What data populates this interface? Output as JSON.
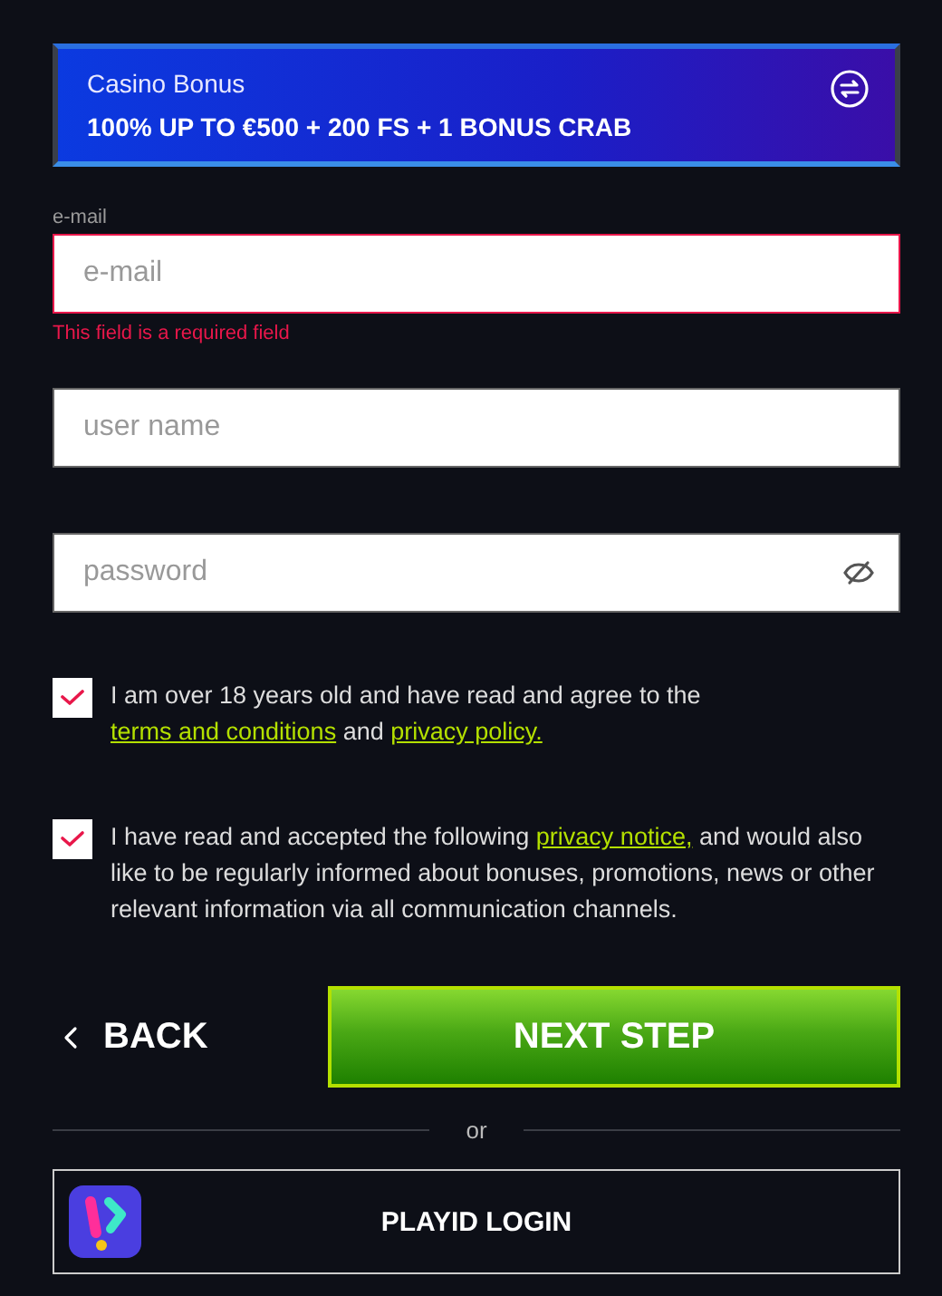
{
  "bonus": {
    "label": "Casino Bonus",
    "offer": "100% UP TO €500 + 200 FS + 1 BONUS CRAB"
  },
  "fields": [
    {
      "kind": "email",
      "label": "e-mail",
      "placeholder": "e-mail",
      "error": "This field is a required field"
    },
    {
      "kind": "text",
      "placeholder": "user name"
    },
    {
      "kind": "password",
      "placeholder": "password"
    }
  ],
  "agreements": [
    {
      "checked": true,
      "parts": [
        {
          "kind": "text",
          "text": "I am over 18 years old and have read and agree to the "
        },
        {
          "kind": "link",
          "text": "terms and conditions"
        },
        {
          "kind": "text",
          "text": " and "
        },
        {
          "kind": "link",
          "text": "privacy policy."
        }
      ]
    },
    {
      "checked": true,
      "parts": [
        {
          "kind": "text",
          "text": "I have read and accepted the following "
        },
        {
          "kind": "link",
          "text": "privacy notice,"
        },
        {
          "kind": "text",
          "text": " and would also like to be regularly informed about bonuses, promotions, news or other relevant information via all communication channels."
        }
      ]
    }
  ],
  "back_button": "BACK",
  "next_button": "NEXT STEP",
  "divider": "or",
  "playid_button": "PLAYID LOGIN"
}
